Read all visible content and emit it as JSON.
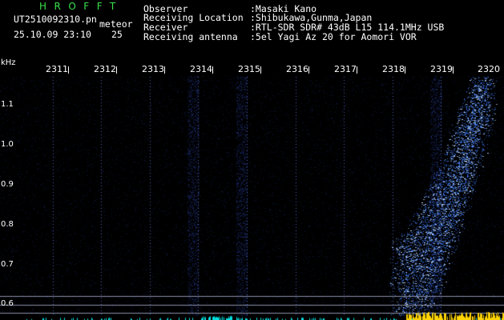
{
  "header": {
    "app_title": "HROFFT",
    "filename": "UT2510092310.pn",
    "mode": "meteor",
    "datetime": "25.10.09 23:10",
    "count": "25",
    "observer_label": "Observer",
    "observer_value": ":Masaki Kano",
    "location_label": "Receiving Location",
    "location_value": ":Shibukawa,Gunma,Japan",
    "receiver_label": "Receiver",
    "receiver_value": ":RTL-SDR SDR# 43dB L15 114.1MHz USB",
    "antenna_label": "Receiving antenna",
    "antenna_value": ":5el Yagi Az 20 for Aomori VOR"
  },
  "axes": {
    "y_unit": "kHz",
    "time_ticks": [
      "2311",
      "2312",
      "2313",
      "2314",
      "2315",
      "2316",
      "2317",
      "2318",
      "2319",
      "2320"
    ],
    "freq_ticks": [
      "1.1",
      "1.0",
      "0.9",
      "0.8",
      "0.7",
      "0.6"
    ]
  },
  "colors": {
    "background": "#000000",
    "title": "#39e04a",
    "text": "#ffffff",
    "signal": "#3f7dff",
    "signal_bright": "#b8d6ff",
    "baseline": "#ffd400",
    "baseline_alt": "#00e0e0",
    "grid_dots": "#4b5fb0"
  },
  "spectrogram": {
    "x_range": [
      "2310",
      "2320"
    ],
    "y_range_khz": [
      0.58,
      1.15
    ],
    "grid": "dotted",
    "reference_lines_khz": [
      0.62,
      0.6
    ],
    "faint_vertical_streaks_min": [
      "2314",
      "2315",
      "2319"
    ],
    "meteor_echo": "dense blue echo trail rising steeply from about 0.6 kHz near 2318 to about 1.15 kHz at 2320"
  }
}
